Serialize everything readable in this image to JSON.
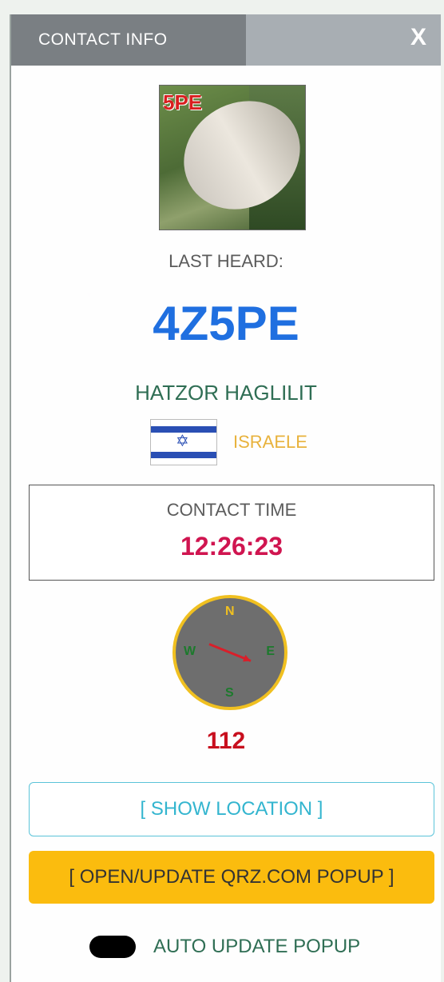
{
  "header": {
    "title": "CONTACT INFO",
    "close_label": "X"
  },
  "photo": {
    "overlay_text": "5PE",
    "icon": "station-photo"
  },
  "last_heard_label": "LAST HEARD:",
  "callsign": "4Z5PE",
  "city": "HATZOR HAGLILIT",
  "country": {
    "name": "ISRAELE",
    "flag_icon": "israel-flag-icon"
  },
  "contact": {
    "label": "CONTACT TIME",
    "time": "12:26:23"
  },
  "compass": {
    "n": "N",
    "s": "S",
    "w": "W",
    "e": "E",
    "bearing_degrees": 112
  },
  "bearing_text": "112",
  "buttons": {
    "show_location": "[ SHOW LOCATION ]",
    "qrz_popup": "[ OPEN/UPDATE QRZ.COM POPUP ]"
  },
  "auto_update": {
    "label": "AUTO UPDATE POPUP",
    "enabled": false
  },
  "colors": {
    "callsign": "#1f6fe0",
    "time": "#d01550",
    "country": "#e8b23c",
    "qrz_button": "#fbbc0e",
    "location_button": "#33b5cf"
  }
}
